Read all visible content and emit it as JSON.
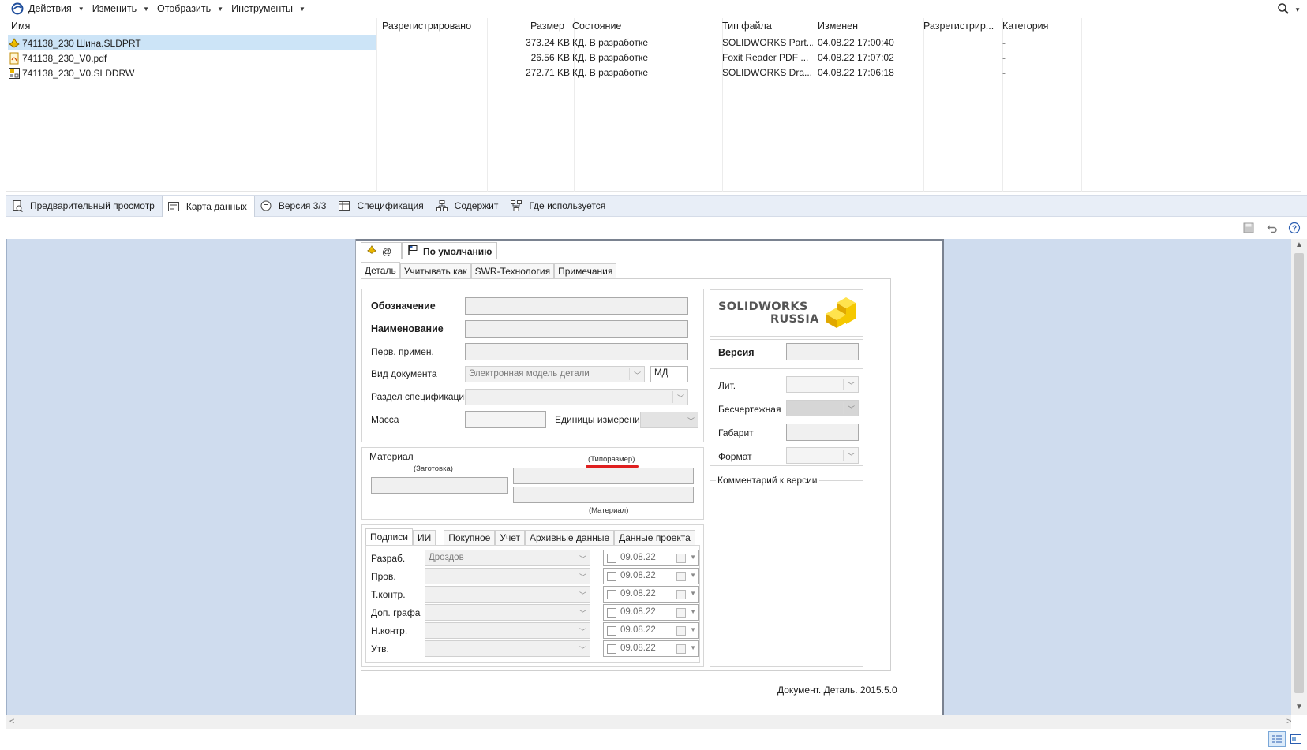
{
  "menubar": {
    "items": [
      {
        "label": "Действия"
      },
      {
        "label": "Изменить"
      },
      {
        "label": "Отобразить"
      },
      {
        "label": "Инструменты"
      }
    ]
  },
  "filelist": {
    "columns": [
      "Имя",
      "Разрегистрировано",
      "Размер",
      "Состояние",
      "Тип файла",
      "Изменен",
      "Разрегистрир...",
      "Категория"
    ],
    "rows": [
      {
        "name": "741138_230 Шина.SLDPRT",
        "icon": "part-icon",
        "checked_out": "",
        "size": "373.24 KB",
        "state": "КД. В разработке",
        "type": "SOLIDWORKS Part...",
        "modified": "04.08.22 17:00:40",
        "checked_out_by": "",
        "category": "-"
      },
      {
        "name": "741138_230_V0.pdf",
        "icon": "pdf-icon",
        "checked_out": "",
        "size": "26.56 KB",
        "state": "КД. В разработке",
        "type": "Foxit Reader PDF ...",
        "modified": "04.08.22 17:07:02",
        "checked_out_by": "",
        "category": "-"
      },
      {
        "name": "741138_230_V0.SLDDRW",
        "icon": "drawing-icon",
        "checked_out": "",
        "size": "272.71 KB",
        "state": "КД. В разработке",
        "type": "SOLIDWORKS Dra...",
        "modified": "04.08.22 17:06:18",
        "checked_out_by": "",
        "category": "-"
      }
    ]
  },
  "tabs": {
    "preview": "Предварительный просмотр",
    "datacard": "Карта данных",
    "version": "Версия 3/3",
    "bom": "Спецификация",
    "contains": "Содержит",
    "where_used": "Где используется"
  },
  "card": {
    "config_tabs": [
      "@",
      "По умолчанию"
    ],
    "form_tabs": [
      "Деталь",
      "Учитывать как",
      "SWR-Технология",
      "Примечания"
    ],
    "fields": {
      "designation": "Обозначение",
      "name": "Наименование",
      "first_use": "Перв. примен.",
      "doc_type": "Вид документа",
      "doc_type_value": "Электронная модель детали",
      "doc_code": "МД",
      "spec_section": "Раздел спецификации",
      "mass": "Масса",
      "units": "Единицы измерения"
    },
    "material": {
      "title": "Материал",
      "blank": "(Заготовка)",
      "size": "(Типоразмер)",
      "material": "(Материал)"
    },
    "logo": {
      "line1": "SOLIDWORKS",
      "line2": "RUSSIA"
    },
    "version_label": "Версия",
    "right_fields": [
      "Лит.",
      "Бесчертежная",
      "Габарит",
      "Формат"
    ],
    "comment_label": "Комментарий к версии",
    "sig_tabs": [
      "Подписи",
      "ИИ",
      "Покупное",
      "Учет",
      "Архивные данные",
      "Данные проекта"
    ],
    "signatures": [
      {
        "role": "Разраб.",
        "person": "Дроздов",
        "date": "09.08.22"
      },
      {
        "role": "Пров.",
        "person": "",
        "date": "09.08.22"
      },
      {
        "role": "Т.контр.",
        "person": "",
        "date": "09.08.22"
      },
      {
        "role": "Доп. графа",
        "person": "",
        "date": "09.08.22"
      },
      {
        "role": "Н.контр.",
        "person": "",
        "date": "09.08.22"
      },
      {
        "role": "Утв.",
        "person": "",
        "date": "09.08.22"
      }
    ],
    "footer": "Документ. Деталь. 2015.5.0"
  },
  "colors": {
    "selection": "#cce4f7",
    "viewer_bg": "#cfdcee",
    "underline": "#e02020",
    "logo_yellow": "#f5c800"
  }
}
